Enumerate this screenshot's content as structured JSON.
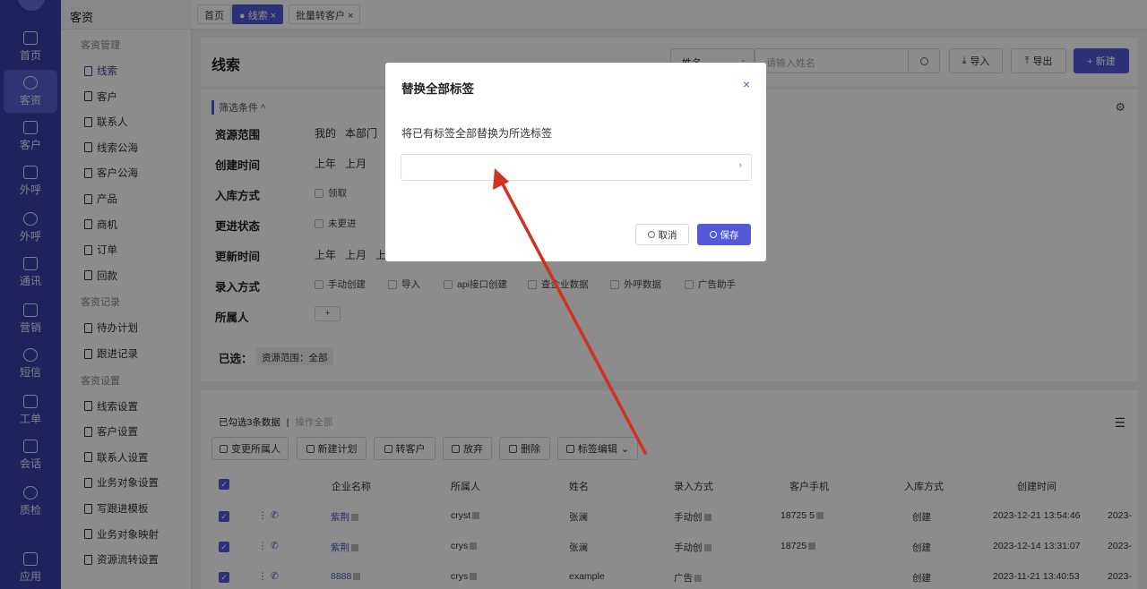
{
  "rail": {
    "items": [
      {
        "label": "首页",
        "icon": "home-icon"
      },
      {
        "label": "客资",
        "icon": "users-icon"
      },
      {
        "label": "客户",
        "icon": "person-icon"
      },
      {
        "label": "外呼",
        "icon": "phone-out-icon"
      },
      {
        "label": "外呼",
        "icon": "phone-call-icon"
      },
      {
        "label": "通讯",
        "icon": "contacts-icon"
      },
      {
        "label": "营销",
        "icon": "megaphone-icon"
      },
      {
        "label": "短信",
        "icon": "message-icon"
      },
      {
        "label": "工单",
        "icon": "clipboard-icon"
      },
      {
        "label": "会话",
        "icon": "chat-icon"
      },
      {
        "label": "质检",
        "icon": "calendar-check-icon"
      },
      {
        "label": "应用",
        "icon": "apps-icon"
      }
    ]
  },
  "sidebar": {
    "title": "客资",
    "groups": [
      {
        "label": "客资管理",
        "items": [
          "线索",
          "客户",
          "联系人",
          "线索公海",
          "客户公海",
          "产品",
          "商机",
          "订单",
          "回款"
        ]
      },
      {
        "label": "客资记录",
        "items": [
          "待办计划",
          "跟进记录"
        ]
      },
      {
        "label": "客资设置",
        "items": [
          "线索设置",
          "客户设置",
          "联系人设置",
          "业务对象设置",
          "写跟进模板",
          "业务对象映射",
          "资源流转设置"
        ]
      }
    ]
  },
  "tabs": [
    {
      "label": "首页"
    },
    {
      "label": "● 线索 ×"
    },
    {
      "label": "批量转客户 ×"
    }
  ],
  "header": {
    "title": "线索",
    "search_select": "姓名",
    "search_placeholder": "请输入姓名",
    "import_label": "导入",
    "export_label": "导出",
    "new_label": "+ 新建"
  },
  "filters": {
    "toggle": "筛选条件 ^",
    "rows": [
      {
        "label": "资源范围",
        "options": [
          "我的",
          "本部门"
        ]
      },
      {
        "label": "创建时间",
        "options": [
          "上年",
          "上月"
        ]
      },
      {
        "label": "入库方式",
        "checks": [
          "领取"
        ]
      },
      {
        "label": "更进状态",
        "checks": [
          "未更进"
        ]
      },
      {
        "label": "更新时间",
        "options": [
          "上年",
          "上月",
          "上"
        ]
      },
      {
        "label": "录入方式",
        "checks": [
          "手动创建",
          "导入",
          "api接口创建",
          "查企业数据",
          "外呼数据",
          "广告助手"
        ]
      },
      {
        "label": "所属人",
        "add": "+"
      }
    ],
    "selected_label": "已选：",
    "selected_chip": "资源范围：全部"
  },
  "table": {
    "selection_text": "已勾选3条数据",
    "action_all": "操作全部",
    "toolbar": [
      "变更所属人",
      "新建计划",
      "转客户",
      "放弃",
      "删除",
      "标签编辑"
    ],
    "columns": [
      "企业名称",
      "所属人",
      "姓名",
      "录入方式",
      "客户手机",
      "入库方式",
      "创建时间"
    ],
    "rows": [
      {
        "company": "紫荆",
        "owner": "cryst",
        "name": "张澜",
        "source": "手动创",
        "phone": "18725 5",
        "storage": "创建",
        "created": "2023-12-21 13:54:46",
        "extra": "2023-"
      },
      {
        "company": "紫荆",
        "owner": "crys",
        "name": "张澜",
        "source": "手动创",
        "phone": "18725",
        "storage": "创建",
        "created": "2023-12-14 13:31:07",
        "extra": "2023-"
      },
      {
        "company": "8888",
        "owner": "crys",
        "name": "example",
        "source": "广告",
        "phone": "",
        "storage": "创建",
        "created": "2023-11-21 13:40:53",
        "extra": "2023-"
      }
    ]
  },
  "modal": {
    "title": "替换全部标签",
    "description": "将已有标签全部替换为所选标签",
    "select_placeholder": "",
    "cancel_label": "取消",
    "save_label": "保存"
  },
  "colors": {
    "primary": "#5558d9",
    "rail": "#3b3fa8",
    "arrow": "#d0321f"
  }
}
